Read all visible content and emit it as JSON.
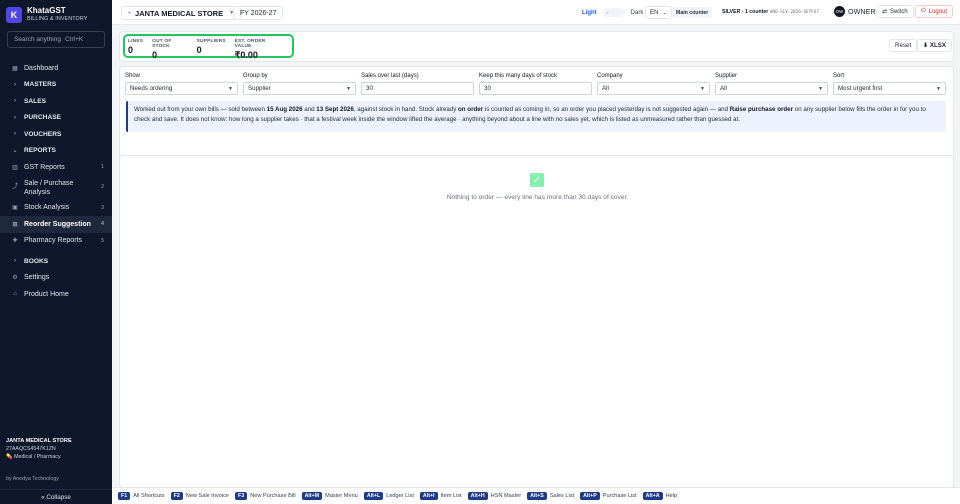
{
  "brand": {
    "name": "KhataGST",
    "subtitle": "BILLING & INVENTORY",
    "logo_letter": "K"
  },
  "search": {
    "placeholder": "Search anything",
    "shortcut": "Ctrl+K"
  },
  "nav": {
    "dashboard": "Dashboard",
    "masters": "MASTERS",
    "sales": "SALES",
    "purchase": "PURCHASE",
    "vouchers": "VOUCHERS",
    "reports": "REPORTS",
    "reports_items": [
      {
        "label": "GST Reports",
        "badge": "1"
      },
      {
        "label": "Sale / Purchase Analysis",
        "badge": "2"
      },
      {
        "label": "Stock Analysis",
        "badge": "3"
      },
      {
        "label": "Reorder Suggestion",
        "badge": "4"
      },
      {
        "label": "Pharmacy Reports",
        "badge": "5"
      }
    ],
    "books": "BOOKS",
    "settings": "Settings",
    "product_home": "Product Home"
  },
  "store_info": {
    "name": "JANTA MEDICAL STORE",
    "gstin": "27AAQCS4547K1ZN",
    "type": "Medical / Pharmacy"
  },
  "by": "by Anedya Technology",
  "collapse": "« Collapse",
  "topbar": {
    "store": "JANTA MEDICAL STORE",
    "fy": "FY 2026-27",
    "theme_light": "Light",
    "theme_dark": "Dark",
    "toggle_mark": "✓",
    "lang": "EN",
    "counter": "Main counter",
    "plan": "SILVER · 1 counter",
    "plan_code": "ANO-SLV-2026-4E7F67",
    "role": "OWNER",
    "avatar": "OW",
    "switch": "Switch",
    "logout": "Logout"
  },
  "stats": [
    {
      "label": "LINES",
      "value": "0"
    },
    {
      "label": "OUT OF STOCK",
      "value": "0"
    },
    {
      "label": "SUPPLIERS",
      "value": "0"
    },
    {
      "label": "EST. ORDER VALUE",
      "value": "₹0.00"
    }
  ],
  "actions": {
    "reset": "Reset",
    "xlsx": "⬇ XLSX"
  },
  "filters": {
    "show": {
      "label": "Show",
      "value": "Needs ordering"
    },
    "group_by": {
      "label": "Group by",
      "value": "Supplier"
    },
    "sales_over": {
      "label": "Sales over last (days)",
      "value": "30"
    },
    "keep_days": {
      "label": "Keep this many days of stock",
      "value": "30"
    },
    "company": {
      "label": "Company",
      "value": "All"
    },
    "supplier": {
      "label": "Supplier",
      "value": "All"
    },
    "sort": {
      "label": "Sort",
      "value": "Most urgent first"
    }
  },
  "info": {
    "p1": "Worked out from your own bills — sold between ",
    "d1": "15 Aug 2026",
    "p2": " and ",
    "d2": "13 Sept 2026",
    "p3": ", against stock in hand. Stock already ",
    "b1": "on order",
    "p4": " is counted as coming in, so an order you placed yesterday is not suggested again — and ",
    "b2": "Raise purchase order",
    "p5": " on any supplier below fills the order in for you to check and save. It does not know: how long a supplier takes · that a festival week inside the window lifted the average · anything beyond about a line with no sales yet, which is listed as unmeasured rather than guessed at."
  },
  "empty": {
    "mark": "✓",
    "message": "Nothing to order — every line has more than 30 days of cover."
  },
  "shortcuts": [
    {
      "key": "F1",
      "label": "All Shortcuts"
    },
    {
      "key": "F2",
      "label": "New Sale Invoice"
    },
    {
      "key": "F3",
      "label": "New Purchase Bill"
    },
    {
      "key": "Alt+M",
      "label": "Master Menu"
    },
    {
      "key": "Alt+L",
      "label": "Ledger List"
    },
    {
      "key": "Alt+I",
      "label": "Item List"
    },
    {
      "key": "Alt+H",
      "label": "HSN Master"
    },
    {
      "key": "Alt+S",
      "label": "Sales List"
    },
    {
      "key": "Alt+P",
      "label": "Purchase List"
    },
    {
      "key": "Alt+A",
      "label": "Help"
    }
  ]
}
